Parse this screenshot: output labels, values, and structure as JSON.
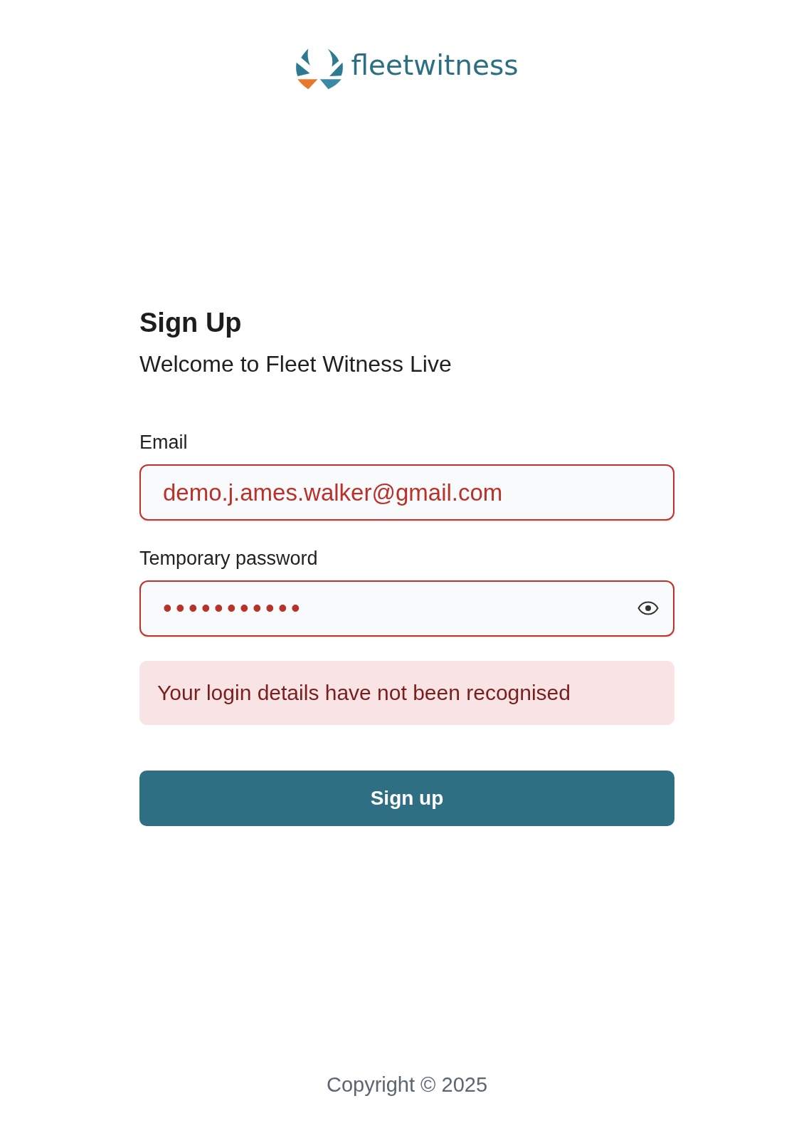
{
  "logo": {
    "wordmark": "fleetwitness"
  },
  "form": {
    "title": "Sign Up",
    "subtitle": "Welcome to Fleet Witness Live",
    "fields": [
      {
        "kind": "email",
        "label": "Email",
        "value": "demo.j.ames.walker@gmail.com",
        "invalid": true
      },
      {
        "kind": "password",
        "label": "Temporary password",
        "value": "•••••••••••",
        "invalid": true
      }
    ],
    "error": "Your login details have not been recognised",
    "submit": "Sign up"
  },
  "footer": {
    "copyright": "Copyright © 2025"
  }
}
